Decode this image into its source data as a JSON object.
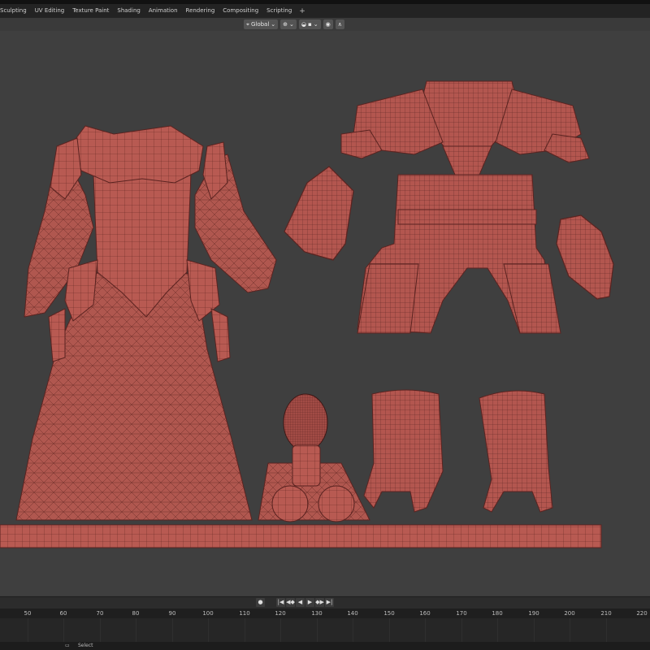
{
  "workspace_tabs": [
    "Sculpting",
    "UV Editing",
    "Texture Paint",
    "Shading",
    "Animation",
    "Rendering",
    "Compositing",
    "Scripting"
  ],
  "add_tab_label": "+",
  "header": {
    "orientation_label": "Global",
    "orientation_arrow": "⌄"
  },
  "transport_glyphs": [
    "|◀",
    "◀◆",
    "◀",
    "▶",
    "◆▶",
    "▶|"
  ],
  "record_glyph": "●",
  "timeline_ticks": [
    "50",
    "60",
    "70",
    "80",
    "90",
    "100",
    "110",
    "120",
    "130",
    "140",
    "150",
    "160",
    "170",
    "180",
    "190",
    "200",
    "210",
    "220"
  ],
  "status": {
    "select_label": "Select"
  },
  "viewport": {
    "objects": [
      "dress",
      "cuirass",
      "left-pauldron-piece",
      "right-pauldron-piece",
      "gnome-figure",
      "left-greave",
      "right-greave",
      "base-plate"
    ],
    "mesh_color": "#b3564f",
    "background_color": "#3f3f3f"
  }
}
